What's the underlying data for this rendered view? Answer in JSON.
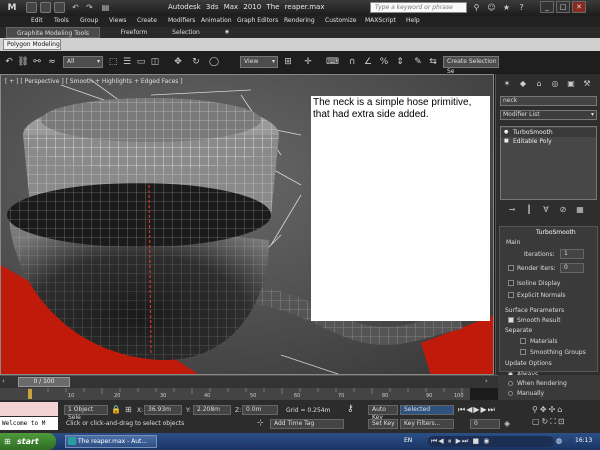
{
  "titlebar": {
    "logo": "M",
    "title": "Autodesk 3ds Max  2010      The reaper.max",
    "search_placeholder": "Type a keyword or phrase"
  },
  "menu": [
    "Edit",
    "Tools",
    "Group",
    "Views",
    "Create",
    "Modifiers",
    "Animation",
    "Graph Editors",
    "Rendering",
    "Customize",
    "MAXScript",
    "Help"
  ],
  "ribbon": {
    "tabs": [
      "Graphite Modeling Tools",
      "Freeform",
      "Selection"
    ],
    "sub_tab": "Polygon Modeling"
  },
  "toolbar": {
    "filter": "All",
    "ref_coord": "View",
    "named_selection": "Create Selection Se"
  },
  "viewport": {
    "label": "[ + ] [ Perspective ] [ Smooth + Highlights + Edged Faces ]",
    "note": "The neck is a simple hose primitive, that had extra side added."
  },
  "command_panel": {
    "object_name": "neck",
    "modifier_list": "Modifier List",
    "stack": [
      "TurboSmooth",
      "Editable Poly"
    ],
    "rollout": {
      "title": "TurboSmooth",
      "main_label": "Main",
      "iterations_label": "Iterations:",
      "iterations_value": "1",
      "render_iters_label": "Render Iters:",
      "render_iters_value": "0",
      "isoline_label": "Isoline Display",
      "explicit_normals_label": "Explicit Normals",
      "surface_label": "Surface Parameters",
      "smooth_result_label": "Smooth Result",
      "separate_label": "Separate",
      "materials_label": "Materials",
      "smoothing_groups_label": "Smoothing Groups",
      "update_label": "Update Options",
      "always_label": "Always",
      "when_rendering_label": "When Rendering",
      "manually_label": "Manually"
    }
  },
  "timeline": {
    "slider": "0 / 100",
    "ticks": [
      "10",
      "20",
      "30",
      "40",
      "50",
      "60",
      "70",
      "80",
      "90",
      "100"
    ]
  },
  "status": {
    "listener": "Welcome to M",
    "selection": "1 Object Sele",
    "prompt": "Click or click-and-drag to select objects",
    "x_label": "X:",
    "x_value": "36.93m",
    "y_label": "Y:",
    "y_value": "2.208m",
    "z_label": "Z:",
    "z_value": "0.0m",
    "grid": "Grid = 0.254m",
    "add_time_tag": "Add Time Tag",
    "auto_key": "Auto Key",
    "selected": "Selected",
    "set_key": "Set Key",
    "key_filters": "Key Filters...",
    "frame": "0"
  },
  "taskbar": {
    "start": "start",
    "task": "The reaper.max - Aut...",
    "lang": "EN",
    "clock": "16:13"
  },
  "colors": {
    "viewport_bg": "#505050",
    "ground_red": "#c01a0a",
    "taskbar": "#2b4f86",
    "start_green": "#3f8a30"
  }
}
